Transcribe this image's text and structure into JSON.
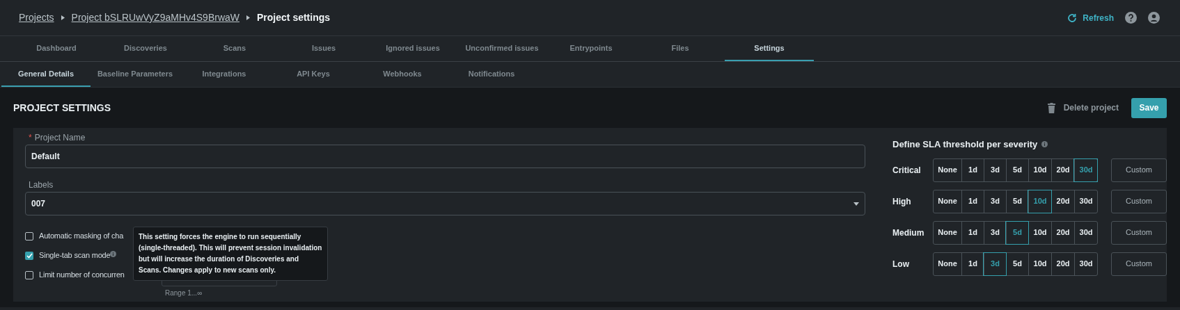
{
  "breadcrumbs": [
    {
      "label": "Projects",
      "kind": "link"
    },
    {
      "label": "Project bSLRUwVyZ9aMHv4S9BrwaW",
      "kind": "link"
    },
    {
      "label": "Project settings",
      "kind": "current"
    }
  ],
  "refresh": {
    "label": "Refresh"
  },
  "tabs": [
    {
      "label": "Dashboard",
      "selected": false
    },
    {
      "label": "Discoveries",
      "selected": false
    },
    {
      "label": "Scans",
      "selected": false
    },
    {
      "label": "Issues",
      "selected": false
    },
    {
      "label": "Ignored issues",
      "selected": false
    },
    {
      "label": "Unconfirmed issues",
      "selected": false
    },
    {
      "label": "Entrypoints",
      "selected": false
    },
    {
      "label": "Files",
      "selected": false
    },
    {
      "label": "Settings",
      "selected": true
    }
  ],
  "subtabs": [
    {
      "label": "General Details",
      "selected": true
    },
    {
      "label": "Baseline Parameters",
      "selected": false
    },
    {
      "label": "Integrations",
      "selected": false
    },
    {
      "label": "API Keys",
      "selected": false
    },
    {
      "label": "Webhooks",
      "selected": false
    },
    {
      "label": "Notifications",
      "selected": false
    }
  ],
  "page_title": "PROJECT SETTINGS",
  "delete_button": "Delete project",
  "save_button": "Save",
  "fields": [
    {
      "label": "Project Name",
      "required": true,
      "required_mark": "*",
      "value": "Default",
      "kind": "text"
    },
    {
      "label": "Labels",
      "required": false,
      "value": "007",
      "kind": "select"
    }
  ],
  "checkboxes": [
    {
      "label": "Automatic masking of cha",
      "checked": false,
      "info": false
    },
    {
      "label": "Single-tab scan mode",
      "checked": true,
      "info": true
    },
    {
      "label": "Limit number of concurren",
      "checked": false,
      "info": false
    }
  ],
  "tooltip": "This setting forces the engine to run sequentially (single-threaded). This will prevent session invalidation but will increase the duration of Discoveries and Scans. Changes apply to new scans only.",
  "concurrency_hint": "Range 1...∞",
  "sla": {
    "title": "Define SLA threshold per severity",
    "rows": [
      {
        "severity": "Critical",
        "custom": "Custom",
        "options": [
          {
            "label": "None",
            "selected": false
          },
          {
            "label": "1d",
            "selected": false
          },
          {
            "label": "3d",
            "selected": false
          },
          {
            "label": "5d",
            "selected": false
          },
          {
            "label": "10d",
            "selected": false
          },
          {
            "label": "20d",
            "selected": false
          },
          {
            "label": "30d",
            "selected": true
          }
        ]
      },
      {
        "severity": "High",
        "custom": "Custom",
        "options": [
          {
            "label": "None",
            "selected": false
          },
          {
            "label": "1d",
            "selected": false
          },
          {
            "label": "3d",
            "selected": false
          },
          {
            "label": "5d",
            "selected": false
          },
          {
            "label": "10d",
            "selected": true
          },
          {
            "label": "20d",
            "selected": false
          },
          {
            "label": "30d",
            "selected": false
          }
        ]
      },
      {
        "severity": "Medium",
        "custom": "Custom",
        "options": [
          {
            "label": "None",
            "selected": false
          },
          {
            "label": "1d",
            "selected": false
          },
          {
            "label": "3d",
            "selected": false
          },
          {
            "label": "5d",
            "selected": true
          },
          {
            "label": "10d",
            "selected": false
          },
          {
            "label": "20d",
            "selected": false
          },
          {
            "label": "30d",
            "selected": false
          }
        ]
      },
      {
        "severity": "Low",
        "custom": "Custom",
        "options": [
          {
            "label": "None",
            "selected": false
          },
          {
            "label": "1d",
            "selected": false
          },
          {
            "label": "3d",
            "selected": true
          },
          {
            "label": "5d",
            "selected": false
          },
          {
            "label": "10d",
            "selected": false
          },
          {
            "label": "20d",
            "selected": false
          },
          {
            "label": "30d",
            "selected": false
          }
        ]
      }
    ]
  }
}
